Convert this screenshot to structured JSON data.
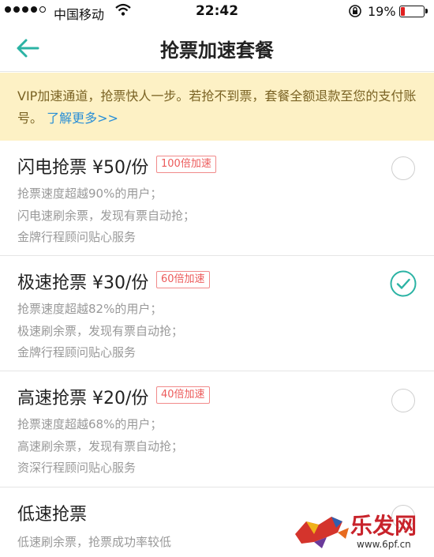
{
  "status_bar": {
    "carrier": "中国移动",
    "time": "22:42",
    "battery": "19%",
    "battery_level": 0.19
  },
  "nav": {
    "title": "抢票加速套餐",
    "back_icon": "arrow-left-icon"
  },
  "notice": {
    "text": "VIP加速通道，抢票快人一步。若抢不到票，套餐全额退款至您的支付账号。",
    "more_link": "了解更多>>"
  },
  "packages": [
    {
      "name": "闪电抢票 ¥50/份",
      "badge": "100倍加速",
      "lines": [
        "抢票速度超越90%的用户；",
        "闪电速刷余票，发现有票自动抢；",
        "金牌行程顾问贴心服务"
      ],
      "selected": false
    },
    {
      "name": "极速抢票 ¥30/份",
      "badge": "60倍加速",
      "lines": [
        "抢票速度超越82%的用户；",
        "极速刷余票，发现有票自动抢；",
        "金牌行程顾问贴心服务"
      ],
      "selected": true
    },
    {
      "name": "高速抢票 ¥20/份",
      "badge": "40倍加速",
      "lines": [
        "抢票速度超越68%的用户；",
        "高速刷余票，发现有票自动抢；",
        "资深行程顾问贴心服务"
      ],
      "selected": false
    },
    {
      "name": "低速抢票",
      "badge": "",
      "lines": [
        "低速刷余票，抢票成功率较低"
      ],
      "selected": false
    }
  ],
  "colors": {
    "accent": "#2bb3a4",
    "badge": "#ec5b5b",
    "notice_bg": "#fdf1c5",
    "link": "#2a8fd6"
  },
  "watermark": {
    "brand": "乐发网",
    "url": "www.6pf.cn"
  }
}
